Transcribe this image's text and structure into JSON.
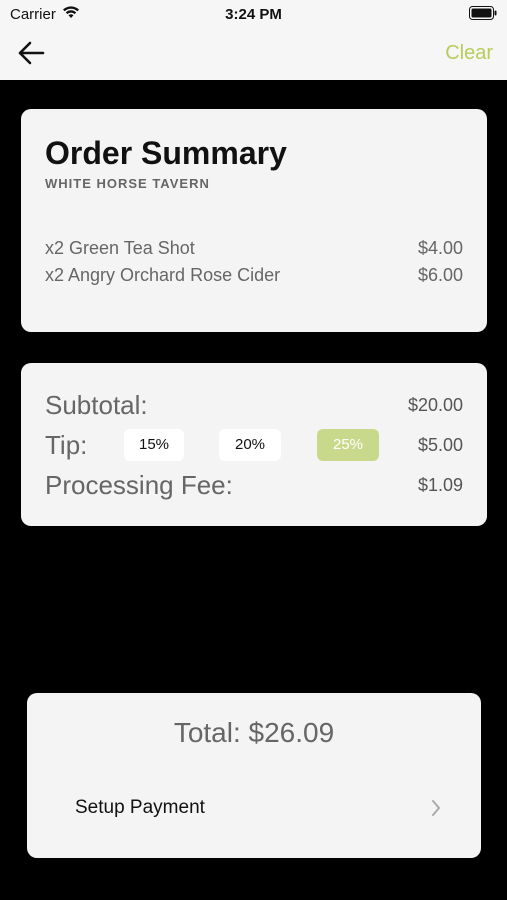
{
  "status_bar": {
    "carrier": "Carrier",
    "time": "3:24 PM"
  },
  "nav": {
    "clear_label": "Clear",
    "back_icon": "arrow-left-icon"
  },
  "summary": {
    "title": "Order Summary",
    "venue": "WHITE HORSE TAVERN",
    "items": [
      {
        "label": "x2 Green Tea Shot",
        "price": "$4.00"
      },
      {
        "label": "x2 Angry Orchard Rose Cider",
        "price": "$6.00"
      }
    ]
  },
  "totals": {
    "subtotal_label": "Subtotal:",
    "subtotal_value": "$20.00",
    "tip_label": "Tip:",
    "tip_options": [
      "15%",
      "20%",
      "25%"
    ],
    "tip_selected": "25%",
    "tip_value": "$5.00",
    "fee_label": "Processing Fee:",
    "fee_value": "$1.09"
  },
  "footer": {
    "total": "Total: $26.09",
    "payment_label": "Setup Payment"
  },
  "colors": {
    "accent": "#b7cc5a",
    "selected_tip": "#c8d98b",
    "card_bg": "#f4f4f4",
    "background": "#000000"
  }
}
